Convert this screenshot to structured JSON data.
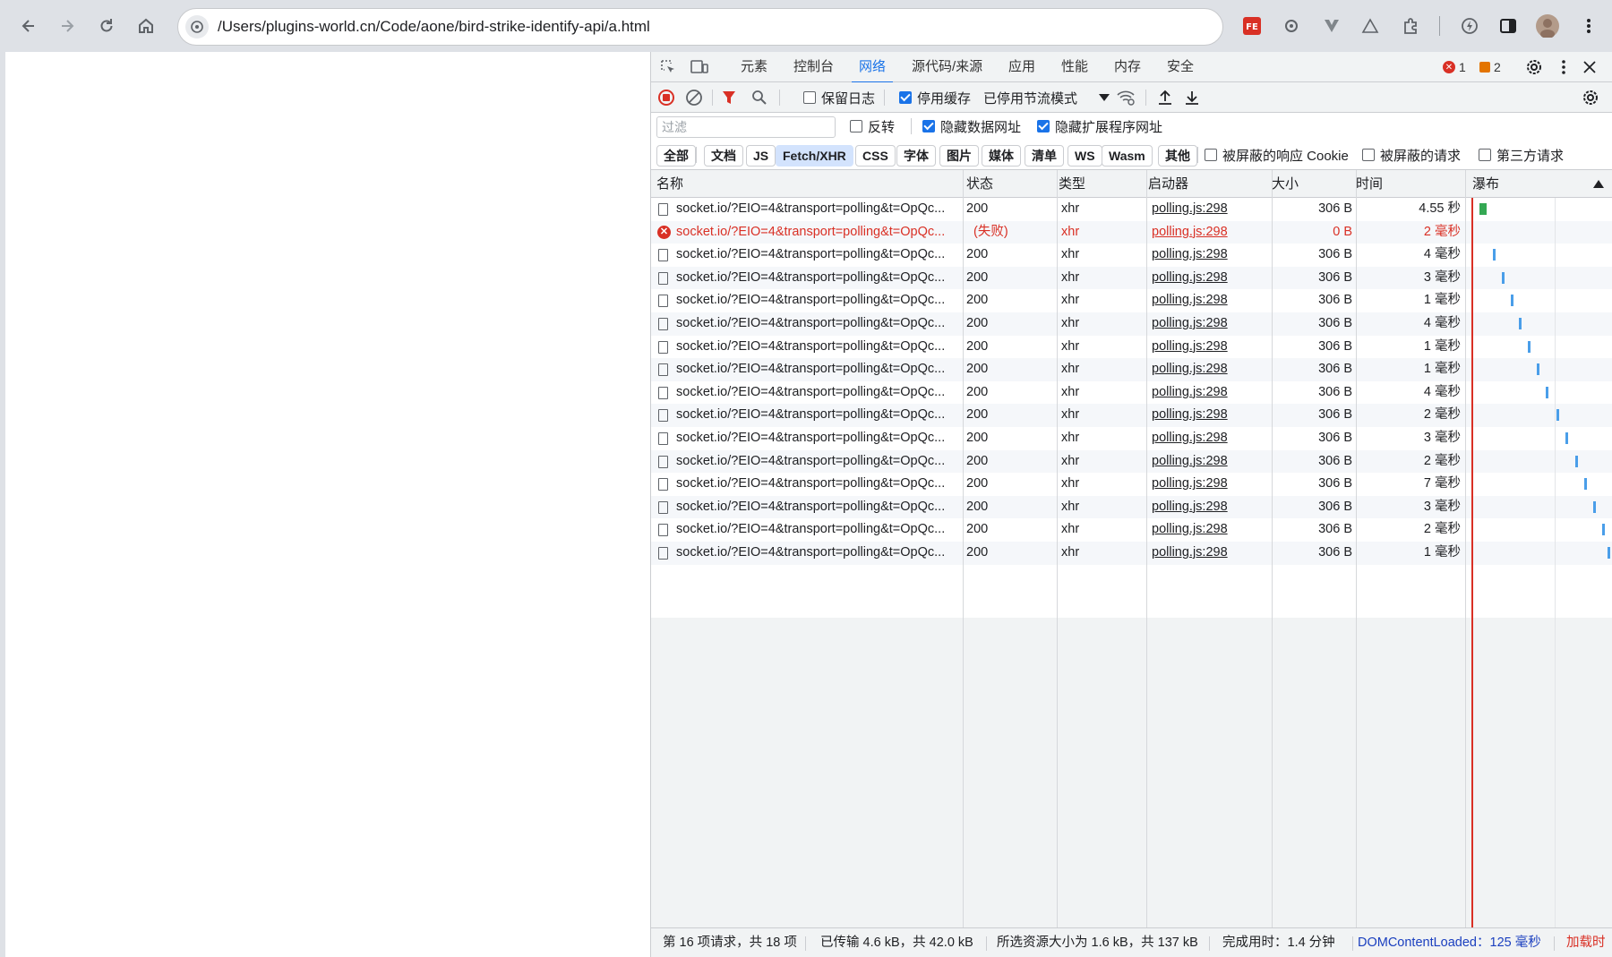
{
  "browser": {
    "url": "/Users/plugins-world.cn/Code/aone/bird-strike-identify-api/a.html",
    "extension_icons": [
      "fe-icon",
      "gear-bug-icon",
      "v-icon",
      "triangle-icon",
      "puzzle-icon",
      "lightning-icon",
      "sidepanel-icon",
      "avatar",
      "more-icon"
    ]
  },
  "devtools": {
    "tabs": [
      "元素",
      "控制台",
      "网络",
      "源代码/来源",
      "应用",
      "性能",
      "内存",
      "安全"
    ],
    "active_tab": "网络",
    "error_count": "1",
    "warning_count": "2",
    "toolbar": {
      "preserve_log": "保留日志",
      "disable_cache": "停用缓存",
      "throttling": "已停用节流模式"
    },
    "filter": {
      "placeholder": "过滤",
      "invert": "反转",
      "hide_data_urls": "隐藏数据网址",
      "hide_extension_urls": "隐藏扩展程序网址"
    },
    "types": [
      "全部",
      "文档",
      "JS",
      "Fetch/XHR",
      "CSS",
      "字体",
      "图片",
      "媒体",
      "清单",
      "WS",
      "Wasm",
      "其他"
    ],
    "active_type": "Fetch/XHR",
    "type_options": {
      "blocked_cookies": "被屏蔽的响应 Cookie",
      "blocked_requests": "被屏蔽的请求",
      "third_party": "第三方请求"
    },
    "columns": [
      "名称",
      "状态",
      "类型",
      "启动器",
      "大小",
      "时间",
      "瀑布"
    ],
    "rows": [
      {
        "name": "socket.io/?EIO=4&transport=polling&t=OpQc...",
        "status": "200",
        "type": "xhr",
        "initiator": "polling.js:298",
        "size": "306 B",
        "time": "4.55 秒",
        "error": false,
        "wf": 0.02
      },
      {
        "name": "socket.io/?EIO=4&transport=polling&t=OpQc...",
        "status": "(失败)",
        "type": "xhr",
        "initiator": "polling.js:298",
        "size": "0 B",
        "time": "2 毫秒",
        "error": true,
        "wf": 0.0
      },
      {
        "name": "socket.io/?EIO=4&transport=polling&t=OpQc...",
        "status": "200",
        "type": "xhr",
        "initiator": "polling.js:298",
        "size": "306 B",
        "time": "4 毫秒",
        "error": false,
        "wf": 0.12
      },
      {
        "name": "socket.io/?EIO=4&transport=polling&t=OpQc...",
        "status": "200",
        "type": "xhr",
        "initiator": "polling.js:298",
        "size": "306 B",
        "time": "3 毫秒",
        "error": false,
        "wf": 0.19
      },
      {
        "name": "socket.io/?EIO=4&transport=polling&t=OpQc...",
        "status": "200",
        "type": "xhr",
        "initiator": "polling.js:298",
        "size": "306 B",
        "time": "1 毫秒",
        "error": false,
        "wf": 0.26
      },
      {
        "name": "socket.io/?EIO=4&transport=polling&t=OpQc...",
        "status": "200",
        "type": "xhr",
        "initiator": "polling.js:298",
        "size": "306 B",
        "time": "4 毫秒",
        "error": false,
        "wf": 0.32
      },
      {
        "name": "socket.io/?EIO=4&transport=polling&t=OpQc...",
        "status": "200",
        "type": "xhr",
        "initiator": "polling.js:298",
        "size": "306 B",
        "time": "1 毫秒",
        "error": false,
        "wf": 0.39
      },
      {
        "name": "socket.io/?EIO=4&transport=polling&t=OpQc...",
        "status": "200",
        "type": "xhr",
        "initiator": "polling.js:298",
        "size": "306 B",
        "time": "1 毫秒",
        "error": false,
        "wf": 0.46
      },
      {
        "name": "socket.io/?EIO=4&transport=polling&t=OpQc...",
        "status": "200",
        "type": "xhr",
        "initiator": "polling.js:298",
        "size": "306 B",
        "time": "4 毫秒",
        "error": false,
        "wf": 0.53
      },
      {
        "name": "socket.io/?EIO=4&transport=polling&t=OpQc...",
        "status": "200",
        "type": "xhr",
        "initiator": "polling.js:298",
        "size": "306 B",
        "time": "2 毫秒",
        "error": false,
        "wf": 0.61
      },
      {
        "name": "socket.io/?EIO=4&transport=polling&t=OpQc...",
        "status": "200",
        "type": "xhr",
        "initiator": "polling.js:298",
        "size": "306 B",
        "time": "3 毫秒",
        "error": false,
        "wf": 0.68
      },
      {
        "name": "socket.io/?EIO=4&transport=polling&t=OpQc...",
        "status": "200",
        "type": "xhr",
        "initiator": "polling.js:298",
        "size": "306 B",
        "time": "2 毫秒",
        "error": false,
        "wf": 0.75
      },
      {
        "name": "socket.io/?EIO=4&transport=polling&t=OpQc...",
        "status": "200",
        "type": "xhr",
        "initiator": "polling.js:298",
        "size": "306 B",
        "time": "7 毫秒",
        "error": false,
        "wf": 0.82
      },
      {
        "name": "socket.io/?EIO=4&transport=polling&t=OpQc...",
        "status": "200",
        "type": "xhr",
        "initiator": "polling.js:298",
        "size": "306 B",
        "time": "3 毫秒",
        "error": false,
        "wf": 0.89
      },
      {
        "name": "socket.io/?EIO=4&transport=polling&t=OpQc...",
        "status": "200",
        "type": "xhr",
        "initiator": "polling.js:298",
        "size": "306 B",
        "time": "2 毫秒",
        "error": false,
        "wf": 0.96
      },
      {
        "name": "socket.io/?EIO=4&transport=polling&t=OpQc...",
        "status": "200",
        "type": "xhr",
        "initiator": "polling.js:298",
        "size": "306 B",
        "time": "1 毫秒",
        "error": false,
        "wf": 1.0
      }
    ],
    "status_bar": {
      "requests": "第 16 项请求，共 18 项",
      "transferred": "已传输 4.6 kB，共 42.0 kB",
      "resources": "所选资源大小为 1.6 kB，共 137 kB",
      "finish": "完成用时：1.4 分钟",
      "dom_content_loaded": "DOMContentLoaded：125 毫秒",
      "load": "加载时"
    },
    "colors": {
      "accent": "#1a73e8",
      "error": "#d93025",
      "waterfall": "#4a9ee9",
      "dcl": "#1a3fbf"
    }
  }
}
